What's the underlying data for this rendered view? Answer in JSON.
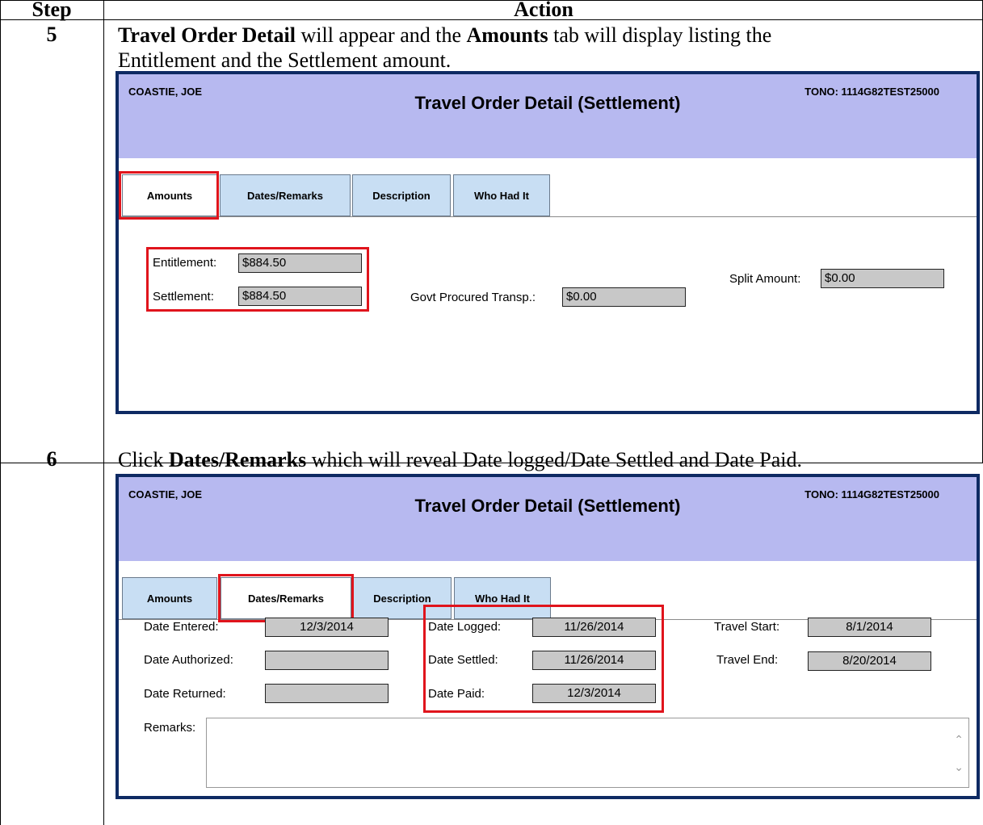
{
  "table": {
    "header": {
      "step": "Step",
      "action": "Action"
    },
    "rows": [
      {
        "step": "5",
        "instruction": {
          "part1_bold": "Travel Order Detail",
          "part2": " will appear and the ",
          "part3_bold": "Amounts",
          "part4": " tab will display listing the",
          "line2": "Entitlement and the Settlement amount."
        }
      },
      {
        "step": "6",
        "instruction": {
          "part1": "Click ",
          "part2_bold": "Dates/Remarks",
          "part3": " which will reveal Date logged/Date Settled and Date Paid."
        }
      }
    ]
  },
  "screen1": {
    "name": "COASTIE, JOE",
    "title": "Travel Order Detail (Settlement)",
    "tono": "TONO: 1114G82TEST25000",
    "tabs": [
      "Amounts",
      "Dates/Remarks",
      "Description",
      "Who Had It"
    ],
    "active_tab": "Amounts",
    "fields": {
      "entitlement_label": "Entitlement:",
      "entitlement_value": "$884.50",
      "settlement_label": "Settlement:",
      "settlement_value": "$884.50",
      "govt_label": "Govt Procured Transp.:",
      "govt_value": "$0.00",
      "split_label": "Split Amount:",
      "split_value": "$0.00"
    }
  },
  "screen2": {
    "name": "COASTIE, JOE",
    "title": "Travel Order Detail (Settlement)",
    "tono": "TONO: 1114G82TEST25000",
    "tabs": [
      "Amounts",
      "Dates/Remarks",
      "Description",
      "Who Had It"
    ],
    "active_tab": "Dates/Remarks",
    "fields": {
      "date_entered_label": "Date Entered:",
      "date_entered_value": "12/3/2014",
      "date_authorized_label": "Date Authorized:",
      "date_authorized_value": "",
      "date_returned_label": "Date Returned:",
      "date_returned_value": "",
      "date_logged_label": "Date Logged:",
      "date_logged_value": "11/26/2014",
      "date_settled_label": "Date Settled:",
      "date_settled_value": "11/26/2014",
      "date_paid_label": "Date Paid:",
      "date_paid_value": "12/3/2014",
      "travel_start_label": "Travel Start:",
      "travel_start_value": "8/1/2014",
      "travel_end_label": "Travel End:",
      "travel_end_value": "8/20/2014",
      "remarks_label": "Remarks:"
    }
  },
  "colors": {
    "titlebar": "#b7b9f0",
    "frame_border": "#0e2a63",
    "tab_bg": "#c8def3",
    "highlight": "#e0141c",
    "field_bg": "#c8c8c8"
  }
}
